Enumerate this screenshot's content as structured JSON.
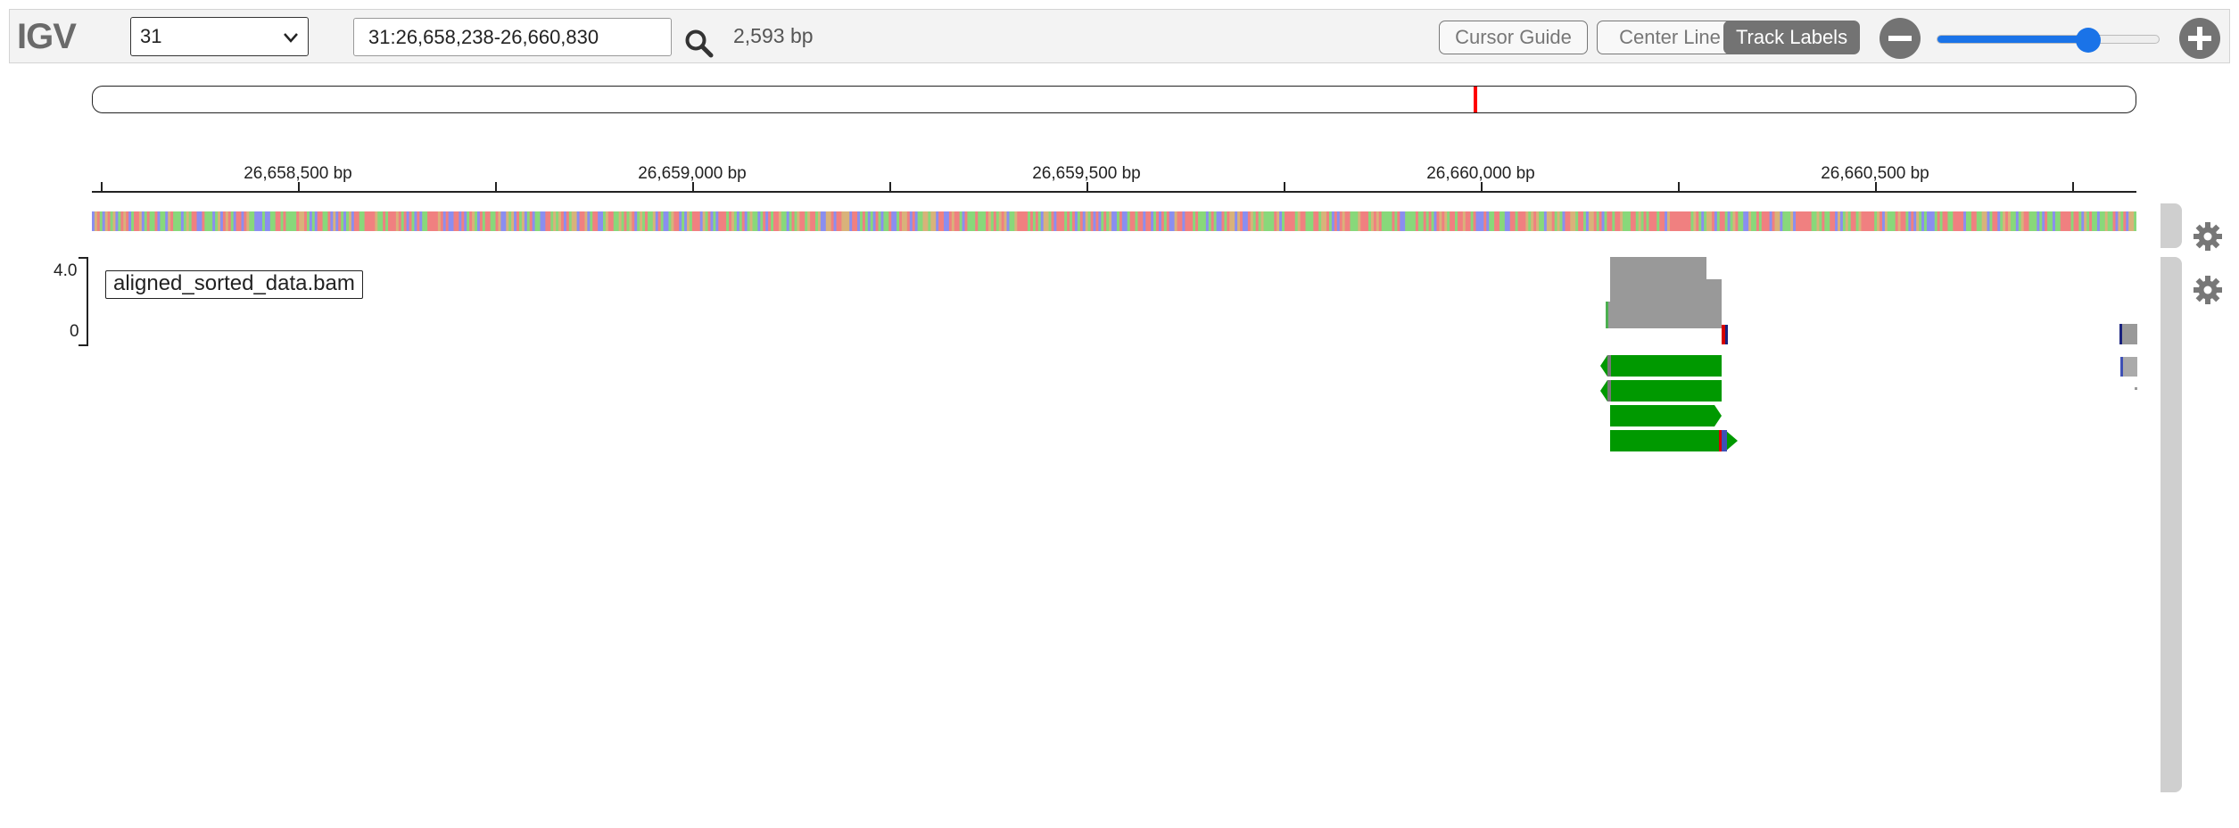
{
  "app": {
    "logo": "IGV"
  },
  "navbar": {
    "chromosome": "31",
    "locus": "31:26,658,238-26,660,830",
    "width_bp": "2,593 bp",
    "buttons": {
      "cursor_guide": "Cursor Guide",
      "center_line": "Center Line",
      "track_labels": "Track Labels"
    },
    "track_labels_active": true,
    "zoom_level": 0.68
  },
  "ideogram": {
    "marker_position": 0.676,
    "marker_color": "#ff0000"
  },
  "ruler": {
    "ticks": [
      {
        "label": "26,658,500 bp"
      },
      {
        "label": "26,659,000 bp"
      },
      {
        "label": "26,659,500 bp"
      },
      {
        "label": "26,660,000 bp"
      },
      {
        "label": "26,660,500 bp"
      }
    ]
  },
  "tracks": {
    "alignment": {
      "name": "aligned_sorted_data.bam",
      "coverage_max": "4.0",
      "coverage_min": "0",
      "coverage_color": "#999999",
      "read_color": "#009900"
    }
  },
  "colors": {
    "accent": "#1a73e8",
    "marker": "#ff0000"
  }
}
